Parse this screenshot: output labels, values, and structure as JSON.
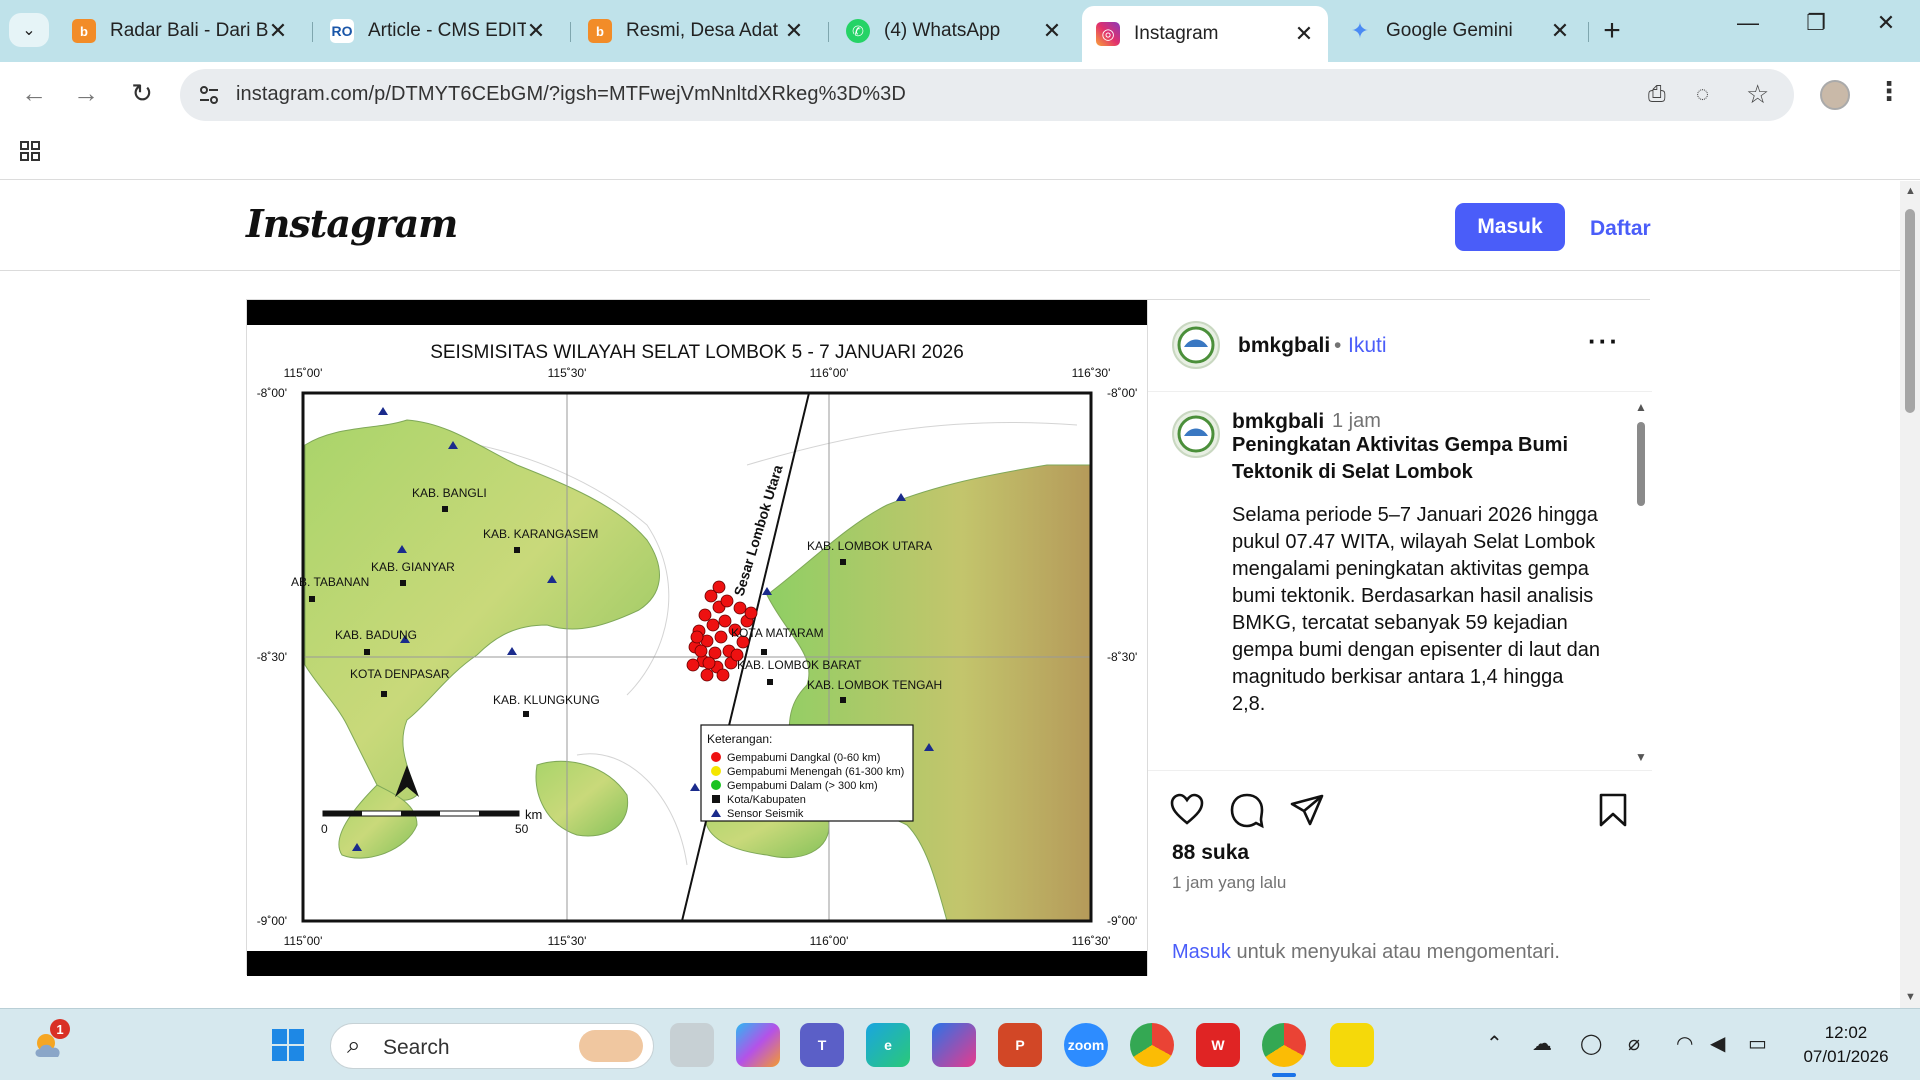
{
  "browser": {
    "tabs": [
      {
        "title": "Radar Bali - Dari Ba",
        "favicon": "radar-bali-icon",
        "color": "#f28c28",
        "glyph": "b"
      },
      {
        "title": "Article - CMS EDIT",
        "favicon": "cms-icon",
        "color": "#1a56a8",
        "glyph": "RO"
      },
      {
        "title": "Resmi, Desa Adat F",
        "favicon": "radar-bali-icon",
        "color": "#f28c28",
        "glyph": "b"
      },
      {
        "title": "(4) WhatsApp",
        "favicon": "whatsapp-icon",
        "color": "#25d366",
        "glyph": "✆"
      },
      {
        "title": "Instagram",
        "favicon": "instagram-icon",
        "color": "#e1306c",
        "glyph": "◎"
      },
      {
        "title": "Google Gemini",
        "favicon": "gemini-icon",
        "color": "#4a8af4",
        "glyph": "✦"
      }
    ],
    "active_tab": 4,
    "url": "instagram.com/p/DTMYT6CEbGM/?igsh=MTFwejVmNnltdXRkeg%3D%3D"
  },
  "instagram": {
    "logo": "Instagram",
    "login_button": "Masuk",
    "signup_link": "Daftar",
    "post": {
      "username": "bmkgbali",
      "follow": "Ikuti",
      "follow_sep": "•",
      "caption": {
        "username": "bmkgbali",
        "time": "1 jam",
        "title": "Peningkatan Aktivitas Gempa Bumi Tektonik di Selat Lombok",
        "body": "Selama periode 5–7 Januari 2026 hingga pukul 07.47 WITA, wilayah Selat Lombok mengalami peningkatan aktivitas gempa bumi tektonik. Berdasarkan hasil analisis BMKG, tercatat sebanyak 59 kejadian gempa bumi dengan episenter di laut dan magnitudo berkisar antara 1,4 hingga 2,8."
      },
      "likes": "88 suka",
      "time_ago": "1 jam yang lalu",
      "login_prompt_link": "Masuk",
      "login_prompt_text": " untuk menyukai atau mengomentari."
    },
    "map": {
      "title": "SEISMISITAS WILAYAH SELAT LOMBOK 5 - 7 JANUARI 2026",
      "lon_ticks": [
        "115˚00'",
        "115˚30'",
        "116˚00'",
        "116˚30'"
      ],
      "lat_ticks": [
        "-8˚00'",
        "-8˚30'",
        "-9˚00'"
      ],
      "fault": "Sesar Lombok Utara",
      "places": [
        "KAB. BANGLI",
        "KAB. KARANGASEM",
        "KAB. GIANYAR",
        "AB. TABANAN",
        "KAB. BADUNG",
        "KOTA DENPASAR",
        "KAB. KLUNGKUNG",
        "KAB. LOMBOK UTARA",
        "KOTA MATARAM",
        "KAB. LOMBOK BARAT",
        "KAB. LOMBOK TENGAH"
      ],
      "legend_title": "Keterangan:",
      "legend": [
        "Gempabumi Dangkal (0-60 km)",
        "Gempabumi Menengah (61-300 km)",
        "Gempabumi Dalam (> 300 km)",
        "Kota/Kabupaten",
        "Sensor Seismik"
      ],
      "scale_zero": "0",
      "scale_fifty": "50",
      "scale_unit": "km"
    }
  },
  "taskbar": {
    "search": "Search",
    "weather_badge": "1",
    "time": "12:02",
    "date": "07/01/2026"
  }
}
